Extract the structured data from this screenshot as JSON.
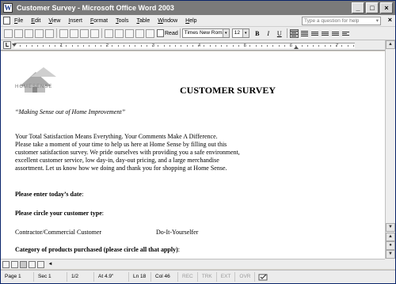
{
  "window": {
    "title": "Customer Survey - Microsoft Office Word 2003",
    "app_icon_glyph": "W",
    "controls": {
      "minimize": "_",
      "maximize": "□",
      "close": "×"
    }
  },
  "menu": {
    "items": [
      "File",
      "Edit",
      "View",
      "Insert",
      "Format",
      "Tools",
      "Table",
      "Window",
      "Help"
    ],
    "help_placeholder": "Type a question for help",
    "help_arrow": "▾",
    "doc_close": "×"
  },
  "toolbar": {
    "read_label": "Read",
    "font_name": "Times New Roman",
    "font_size": "12",
    "bold": "B",
    "italic": "I",
    "underline": "U",
    "dropdown_arrow": "▾"
  },
  "ruler": {
    "tab_selector": "L",
    "numbers": [
      "1",
      "2",
      "3",
      "4",
      "5",
      "6",
      "7"
    ]
  },
  "document": {
    "logo_text": "HOMESENSE",
    "title": "CUSTOMER SURVEY",
    "tagline": "“Making Sense out of Home Improvement”",
    "intro_lines": [
      "Your Total Satisfaction Means Everything. Your Comments Make A Difference.",
      "Please take a moment of your time to help us here at Home Sense by filling out this",
      "customer satisfaction survey. We pride ourselves with providing you a safe environment,",
      "excellent customer service, low day-in, day-out pricing, and a large merchandise",
      "assortment. Let us know how we doing and thank you for shopping at Home Sense."
    ],
    "question_date": "Please enter today’s date",
    "question_type": "Please circle your customer type",
    "colon": ":",
    "option_contractor": "Contractor/Commercial Customer",
    "option_diy": "Do-It-Yourselfer",
    "question_category": "Category of products purchased (please circle all that apply)"
  },
  "status": {
    "page": "Page 1",
    "section": "Sec 1",
    "page_of": "1/2",
    "at": "At 4.9\"",
    "line": "Ln 18",
    "col": "Col 46",
    "rec": "REC",
    "trk": "TRK",
    "ext": "EXT",
    "ovr": "OVR"
  },
  "scrollbar": {
    "up": "▲",
    "down": "▼",
    "prev_page": "▲",
    "next_page": "▼",
    "select_browse": "●",
    "left": "◄"
  }
}
